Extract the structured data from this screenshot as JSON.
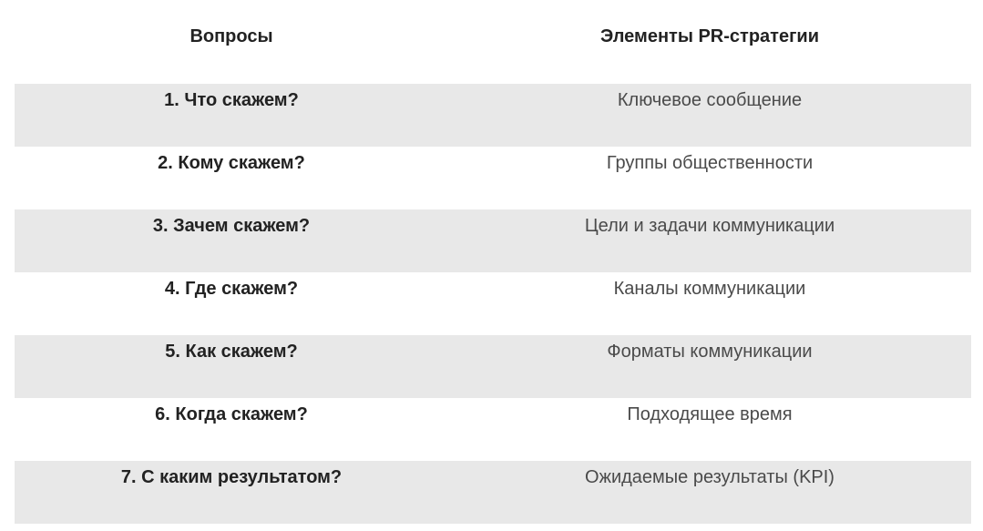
{
  "table": {
    "header": {
      "questions": "Вопросы",
      "elements": "Элементы PR-стратегии"
    },
    "rows": [
      {
        "question": "1. Что скажем?",
        "element": "Ключевое сообщение"
      },
      {
        "question": "2. Кому скажем?",
        "element": "Группы общественности"
      },
      {
        "question": "3. Зачем скажем?",
        "element": "Цели и задачи коммуникации"
      },
      {
        "question": "4. Где скажем?",
        "element": "Каналы коммуникации"
      },
      {
        "question": "5. Как скажем?",
        "element": "Форматы коммуникации"
      },
      {
        "question": "6. Когда скажем?",
        "element": "Подходящее время"
      },
      {
        "question": "7. С каким результатом?",
        "element": "Ожидаемые результаты (KPI)"
      }
    ],
    "colors": {
      "shaded_row": "#e8e8e8",
      "text_dark": "#222222",
      "text_regular": "#4a4a4a"
    }
  }
}
